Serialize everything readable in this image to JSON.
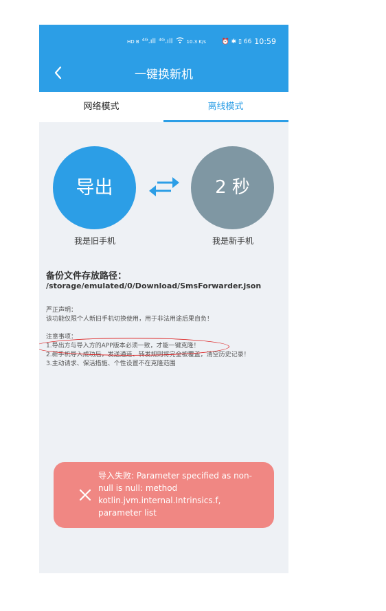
{
  "status_bar": {
    "network_badges": "HD B",
    "signal_1": "⁴ᴳ.ıll",
    "signal_2": "⁴ᴳ.ıll",
    "speed": "10.3 K/s",
    "right_icons": "⏰ ✱ ▯ 66",
    "time": "10:59"
  },
  "header": {
    "title": "一键换新机"
  },
  "tabs": [
    {
      "label": "网络模式",
      "active": false
    },
    {
      "label": "离线模式",
      "active": true
    }
  ],
  "transfer": {
    "export_button": "导出",
    "countdown": "2 秒",
    "old_phone_label": "我是旧手机",
    "new_phone_label": "我是新手机"
  },
  "backup": {
    "title": "备份文件存放路径：",
    "path": "/storage/emulated/0/Download/SmsForwarder.json"
  },
  "disclaimer": {
    "title": "严正声明：",
    "text": "该功能仅限个人新旧手机切换使用，用于非法用途后果自负！"
  },
  "notes": {
    "title": "注意事项：",
    "items": [
      "1.导出方与导入方的APP版本必须一致，才能一键克隆！",
      "2.新手机导入成功后，发送通道、转发规则将完全被覆盖，清空历史记录！",
      "3.主动请求、保活措施、个性设置不在克隆范围"
    ]
  },
  "toast": {
    "message": "导入失败: Parameter specified as non-null is null: method kotlin.jvm.internal.Intrinsics.f, parameter list"
  },
  "colors": {
    "primary": "#2c9ee6",
    "timer_circle": "#7f97a3",
    "toast_bg": "#f08783",
    "highlight": "#dd2222"
  }
}
